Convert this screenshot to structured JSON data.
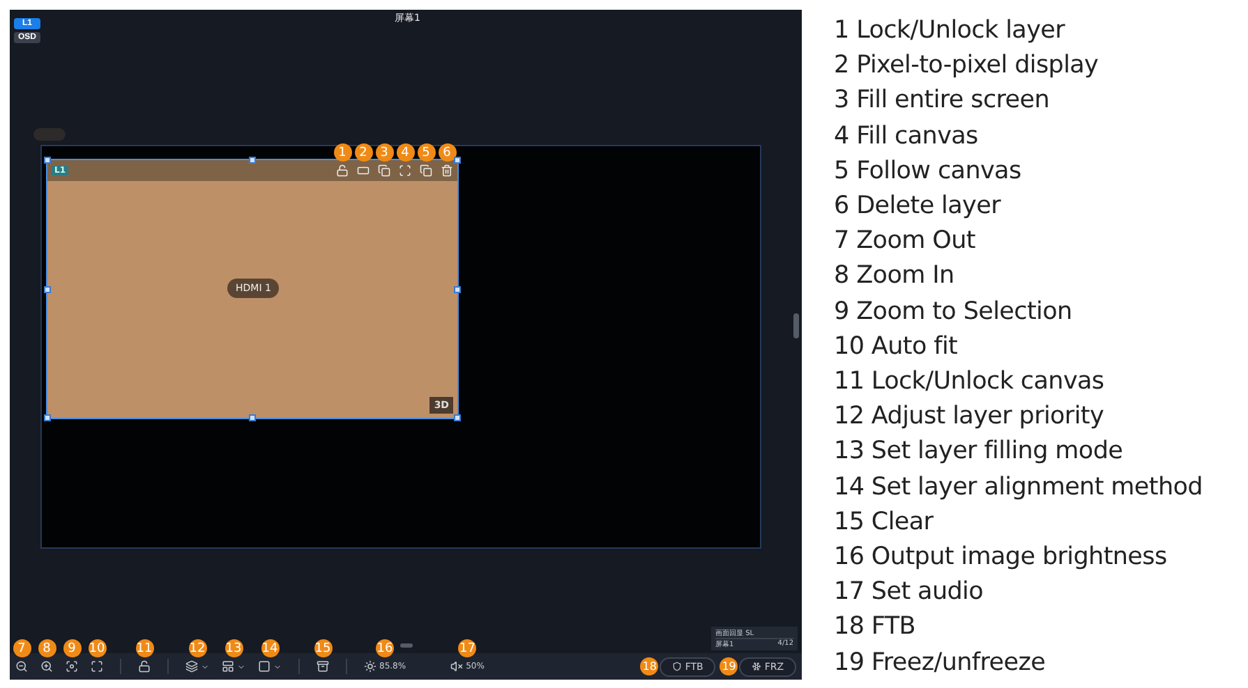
{
  "screen_title": "屏幕1",
  "layer_tabs": [
    {
      "label": "L1",
      "selected": true
    },
    {
      "label": "OSD",
      "selected": false
    }
  ],
  "layer": {
    "tag": "L1",
    "source": "HDMI 1",
    "mode_badge": "3D",
    "selected": true,
    "tools": [
      {
        "badge": "1"
      },
      {
        "badge": "2"
      },
      {
        "badge": "3"
      },
      {
        "badge": "4"
      },
      {
        "badge": "5"
      },
      {
        "badge": "6"
      }
    ]
  },
  "toolbar": [
    {
      "kind": "icon",
      "badge": "7"
    },
    {
      "kind": "icon",
      "badge": "8"
    },
    {
      "kind": "icon",
      "badge": "9"
    },
    {
      "kind": "icon",
      "badge": "10"
    },
    {
      "kind": "icon",
      "badge": "11"
    },
    {
      "kind": "dropdown",
      "badge": "12"
    },
    {
      "kind": "dropdown",
      "badge": "13"
    },
    {
      "kind": "dropdown",
      "badge": "14"
    },
    {
      "kind": "icon",
      "badge": "15"
    },
    {
      "kind": "reading",
      "badge": "16",
      "reading": "85.8%"
    },
    {
      "kind": "reading",
      "badge": "17",
      "reading": "50%"
    }
  ],
  "preview": {
    "title": "画面回显 SL",
    "name": "屏幕1",
    "count": "4/12"
  },
  "buttons": [
    {
      "label": "FTB",
      "badge": "18"
    },
    {
      "label": "FRZ",
      "badge": "19"
    }
  ],
  "legend": [
    "1 Lock/Unlock layer",
    "2 Pixel-to-pixel display",
    "3 Fill entire screen",
    "4 Fill canvas",
    "5 Follow canvas",
    "6 Delete layer",
    "7 Zoom Out",
    "8 Zoom In",
    "9 Zoom to Selection",
    "10 Auto fit",
    "11 Lock/Unlock canvas",
    "12 Adjust layer priority",
    "13 Set layer filling mode",
    "14 Set layer alignment method",
    "15 Clear",
    "16 Output image brightness",
    "17 Set audio",
    "18 FTB",
    "19 Freez/unfreeze"
  ]
}
